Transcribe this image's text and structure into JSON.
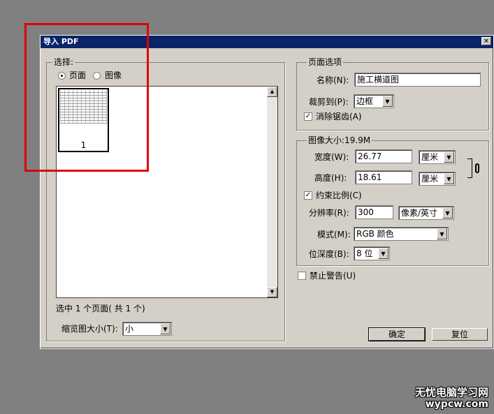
{
  "dialog": {
    "title": "导入 PDF",
    "close_glyph": "✕"
  },
  "select_group": {
    "legend": "选择:",
    "option_page": "页面",
    "option_image": "图像",
    "selected": "页面",
    "thumbnail_page_number": "1",
    "selection_info": "选中 1 个页面( 共 1 个)",
    "thumb_size_label": "缩览图大小(T):",
    "thumb_size_value": "小"
  },
  "page_options": {
    "legend": "页面选项",
    "name_label": "名称(N):",
    "name_value": "施工横道图",
    "crop_label": "裁剪到(P):",
    "crop_value": "边框",
    "antialias_label": "消除锯齿(A)",
    "antialias_checked": true
  },
  "image_size": {
    "legend": "图像大小:19.9M",
    "width_label": "宽度(W):",
    "width_value": "26.77",
    "width_unit": "厘米",
    "height_label": "高度(H):",
    "height_value": "18.61",
    "height_unit": "厘米",
    "constrain_label": "约束比例(C)",
    "constrain_checked": true,
    "resolution_label": "分辨率(R):",
    "resolution_value": "300",
    "resolution_unit": "像素/英寸",
    "mode_label": "模式(M):",
    "mode_value": "RGB 颜色",
    "depth_label": "位深度(B):",
    "depth_value": "8 位"
  },
  "suppress_warnings": {
    "label": "禁止警告(U)",
    "checked": false
  },
  "buttons": {
    "ok": "确定",
    "reset": "复位"
  },
  "watermark": {
    "line1": "无忧电脑学习网",
    "line2": "wypcw.com"
  },
  "colors": {
    "titlebar": "#0a246a",
    "dialog_bg": "#d4d0c8",
    "highlight_box": "#e00000"
  }
}
